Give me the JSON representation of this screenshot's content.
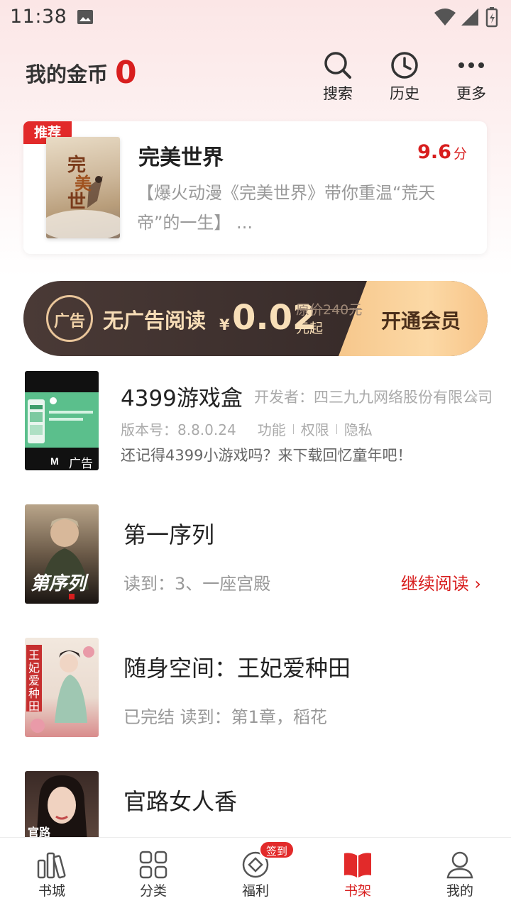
{
  "status_bar": {
    "time": "11:38"
  },
  "header": {
    "coins_label": "我的金币",
    "coins_value": "0",
    "buttons": [
      {
        "label": "搜索",
        "icon": "search-icon"
      },
      {
        "label": "历史",
        "icon": "clock-icon"
      },
      {
        "label": "更多",
        "icon": "more-icon"
      }
    ]
  },
  "recommend": {
    "badge": "推荐",
    "title": "完美世界",
    "score": "9.6",
    "score_unit": "分",
    "description": "【爆火动漫《完美世界》带你重温“荒天帝”的一生】 ..."
  },
  "vip_banner": {
    "ad_icon_text": "广告",
    "text": "无广告阅读",
    "currency": "¥",
    "price": "0.02",
    "original_price": "原价240元",
    "price_suffix": "元起",
    "cta": "开通会员"
  },
  "ad_item": {
    "title": "4399游戏盒",
    "developer": "开发者：四三九九网络股份有限公司",
    "version": "版本号：8.8.0.24",
    "links": [
      "功能",
      "权限",
      "隐私"
    ],
    "description": "还记得4399小游戏吗？来下载回忆童年吧！",
    "ad_label": "广告"
  },
  "books": [
    {
      "title": "第一序列",
      "progress": "读到：3、一座宫殿",
      "action": "继续阅读 ›"
    },
    {
      "title": "随身空间：王妃爱种田",
      "progress": "已完结 读到：第1章，稻花"
    },
    {
      "title": "官路女人香"
    }
  ],
  "bottom_nav": {
    "items": [
      {
        "label": "书城",
        "icon": "bookstore-icon"
      },
      {
        "label": "分类",
        "icon": "category-icon"
      },
      {
        "label": "福利",
        "icon": "welfare-icon",
        "badge": "签到"
      },
      {
        "label": "书架",
        "icon": "bookshelf-icon",
        "active": true
      },
      {
        "label": "我的",
        "icon": "profile-icon"
      }
    ]
  },
  "colors": {
    "accent": "#d81e1e",
    "gold": "#f6c78c",
    "banner_dark": "#3b2e2c"
  }
}
